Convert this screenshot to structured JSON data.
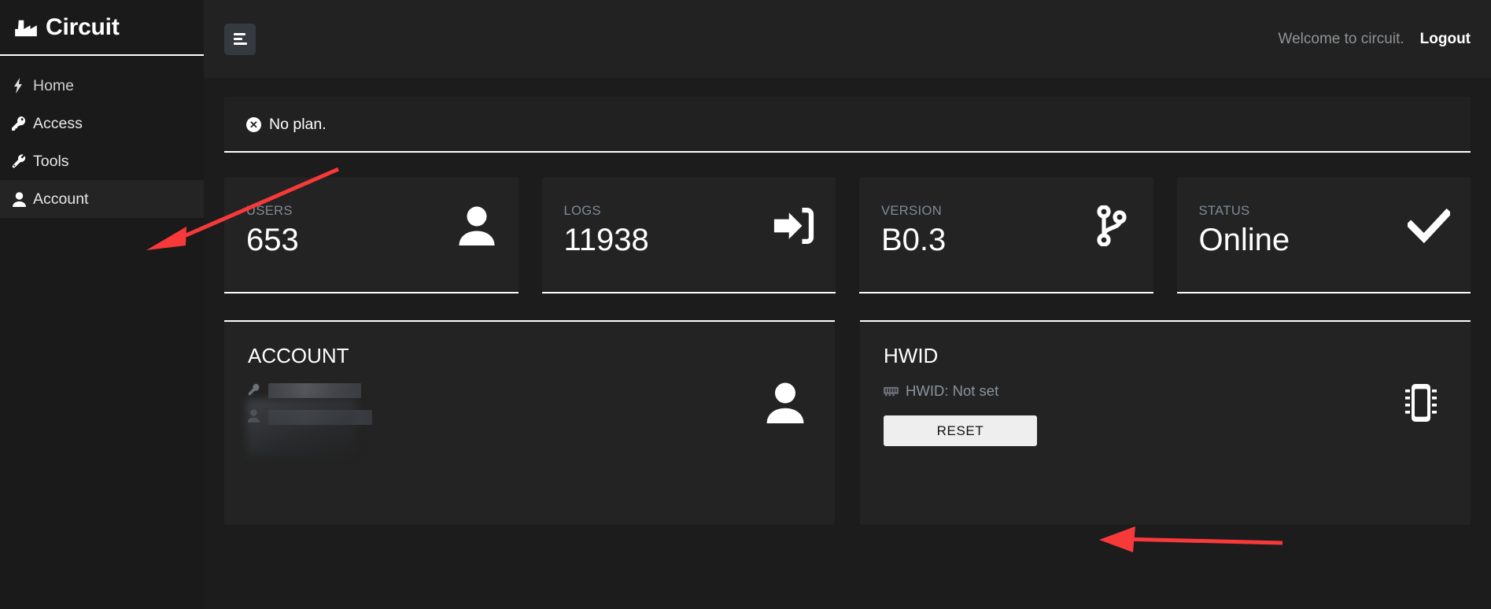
{
  "sidebar": {
    "brand": {
      "title": "Circuit",
      "icon": "factory-icon"
    },
    "items": [
      {
        "label": "Home",
        "icon": "bolt-icon",
        "active": false
      },
      {
        "label": "Access",
        "icon": "key-icon",
        "active": false
      },
      {
        "label": "Tools",
        "icon": "wrench-icon",
        "active": false
      },
      {
        "label": "Account",
        "icon": "user-icon",
        "active": true
      }
    ]
  },
  "topbar": {
    "menu_button": "hamburger-icon",
    "welcome_text": "Welcome to circuit.",
    "logout_label": "Logout"
  },
  "alert": {
    "icon": "circle-x-icon",
    "text": "No plan."
  },
  "stats": [
    {
      "label": "USERS",
      "value": "653",
      "icon": "user-icon"
    },
    {
      "label": "LOGS",
      "value": "11938",
      "icon": "sign-in-icon"
    },
    {
      "label": "VERSION",
      "value": "B0.3",
      "icon": "git-branch-icon"
    },
    {
      "label": "STATUS",
      "value": "Online",
      "icon": "check-icon"
    }
  ],
  "panels": {
    "account": {
      "title": "ACCOUNT",
      "icon": "user-icon",
      "rows": [
        {
          "icon": "key-icon",
          "value": ""
        },
        {
          "icon": "user-icon",
          "value": ""
        }
      ]
    },
    "hwid": {
      "title": "HWID",
      "icon": "memory-chip-icon",
      "status_icon": "memory-icon",
      "status_text": "HWID: Not set",
      "reset_label": "RESET"
    }
  },
  "colors": {
    "page_bg": "#1c1c1c",
    "sidebar_bg": "#1a1a1a",
    "card_bg": "#232323",
    "topbar_bg": "#222222",
    "accent_border": "#ffffff",
    "muted_text": "#7f8a96",
    "annotation_red": "#f7393a",
    "menu_btn_bg": "#343a40"
  }
}
